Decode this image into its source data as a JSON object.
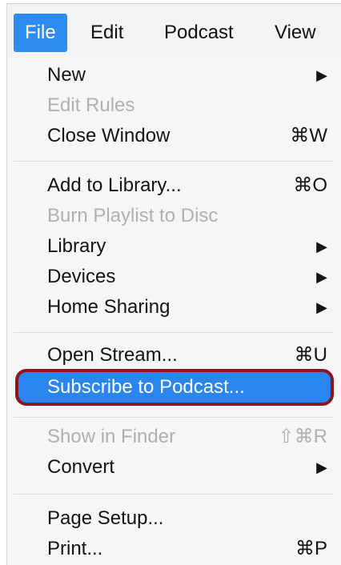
{
  "menubar": {
    "items": [
      {
        "label": "File",
        "active": true
      },
      {
        "label": "Edit",
        "active": false
      },
      {
        "label": "Podcast",
        "active": false
      },
      {
        "label": "View",
        "active": false
      }
    ]
  },
  "menu": {
    "groups": [
      {
        "items": [
          {
            "label": "New",
            "submenu_indicator": "▶",
            "enabled": true
          },
          {
            "label": "Edit Rules",
            "enabled": false
          },
          {
            "label": "Close Window",
            "shortcut": "⌘W",
            "enabled": true
          }
        ]
      },
      {
        "items": [
          {
            "label": "Add to Library...",
            "shortcut": "⌘O",
            "enabled": true
          },
          {
            "label": "Burn Playlist to Disc",
            "enabled": false
          },
          {
            "label": "Library",
            "submenu_indicator": "▶",
            "enabled": true
          },
          {
            "label": "Devices",
            "submenu_indicator": "▶",
            "enabled": true
          },
          {
            "label": "Home Sharing",
            "submenu_indicator": "▶",
            "enabled": true
          }
        ]
      },
      {
        "items": [
          {
            "label": "Open Stream...",
            "shortcut": "⌘U",
            "enabled": true
          },
          {
            "label": "Subscribe to Podcast...",
            "enabled": true,
            "highlighted": true
          }
        ]
      },
      {
        "items": [
          {
            "label": "Show in Finder",
            "shortcut": "⇧⌘R",
            "enabled": false
          },
          {
            "label": "Convert",
            "submenu_indicator": "▶",
            "enabled": true
          }
        ]
      },
      {
        "items": [
          {
            "label": "Page Setup...",
            "enabled": true
          },
          {
            "label": "Print...",
            "shortcut": "⌘P",
            "enabled": true
          }
        ]
      }
    ]
  },
  "colors": {
    "highlight": "#2a85ee",
    "annotation_outline": "#8e1420",
    "disabled_text": "#b0b0b0"
  }
}
